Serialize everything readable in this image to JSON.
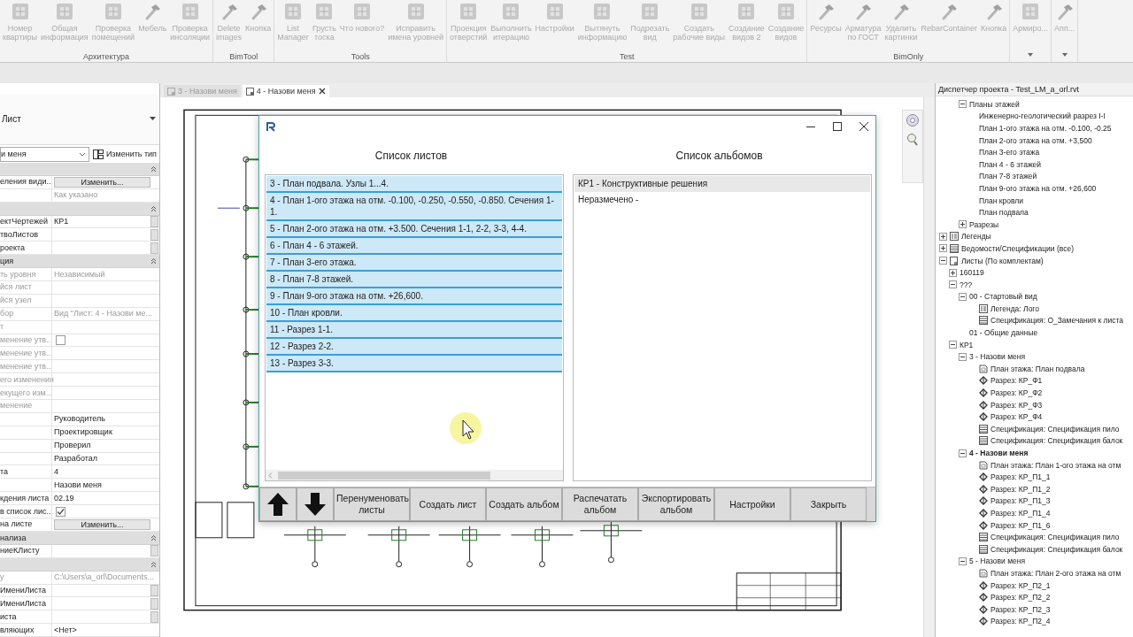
{
  "ribbon": {
    "groups": [
      {
        "title": "Архитектура",
        "dropdown": false,
        "buttons": [
          {
            "kind": "tile",
            "lines": [
              "Номер",
              "квартиры"
            ]
          },
          {
            "kind": "tile",
            "lines": [
              "Общая",
              "информация"
            ]
          },
          {
            "kind": "tile",
            "lines": [
              "Проверка",
              "помещений"
            ]
          },
          {
            "kind": "hammer",
            "lines": [
              "Мебель"
            ]
          },
          {
            "kind": "tile",
            "lines": [
              "Проверка",
              "инсоляции"
            ]
          }
        ]
      },
      {
        "title": "BimTool",
        "dropdown": false,
        "buttons": [
          {
            "kind": "hammer",
            "lines": [
              "Delete",
              "images"
            ]
          },
          {
            "kind": "hammer",
            "lines": [
              "Кнопка"
            ]
          }
        ]
      },
      {
        "title": "Tools",
        "dropdown": false,
        "buttons": [
          {
            "kind": "tile",
            "lines": [
              "List",
              "Manager"
            ]
          },
          {
            "kind": "tile",
            "lines": [
              "Грусть",
              "тоска"
            ]
          },
          {
            "kind": "tile",
            "lines": [
              "Что нового?"
            ]
          },
          {
            "kind": "tile",
            "lines": [
              "Исправить",
              "имена уровней"
            ]
          }
        ]
      },
      {
        "title": "Test",
        "dropdown": false,
        "buttons": [
          {
            "kind": "tile",
            "lines": [
              "Проекция",
              "отверстий"
            ]
          },
          {
            "kind": "tile",
            "lines": [
              "Выполнить",
              "итерацию"
            ]
          },
          {
            "kind": "tile",
            "lines": [
              "Настройки"
            ]
          },
          {
            "kind": "tile",
            "lines": [
              "Вытянуть",
              "информацию"
            ]
          },
          {
            "kind": "tile",
            "lines": [
              "Подрезать",
              "вид"
            ]
          },
          {
            "kind": "tile",
            "lines": [
              "Создать",
              "рабочие виды"
            ]
          },
          {
            "kind": "tile",
            "lines": [
              "Создание",
              "видов 2"
            ]
          },
          {
            "kind": "tile",
            "lines": [
              "Создание",
              "видов"
            ]
          }
        ]
      },
      {
        "title": "BimOnly",
        "dropdown": false,
        "buttons": [
          {
            "kind": "hammer",
            "lines": [
              "Ресурсы"
            ]
          },
          {
            "kind": "hammer",
            "lines": [
              "Арматура",
              "по ГОСТ"
            ]
          },
          {
            "kind": "hammer",
            "lines": [
              "Удалить",
              "картинки"
            ]
          },
          {
            "kind": "hammer",
            "lines": [
              "RebarContainer"
            ]
          },
          {
            "kind": "hammer",
            "lines": [
              "Кнопка"
            ]
          }
        ]
      },
      {
        "dropdown": true,
        "buttons": [
          {
            "kind": "tile",
            "lines": [
              "Армиро..."
            ]
          }
        ]
      },
      {
        "dropdown": true,
        "buttons": [
          {
            "kind": "hammer",
            "lines": [
              "Апп..."
            ]
          }
        ]
      }
    ]
  },
  "properties": {
    "type_name": "Лист",
    "instance_selector": "и меня",
    "edit_type_button": "Изменить тип",
    "rows": [
      {
        "kind": "header"
      },
      {
        "kind": "button",
        "label": "еления види...",
        "button": "Изменить...",
        "disabled": false
      },
      {
        "kind": "text",
        "value": "Как указано",
        "disabled": true
      },
      {
        "kind": "header"
      },
      {
        "kind": "param",
        "label": "ектЧертежей",
        "value": "КР1",
        "disabled": false
      },
      {
        "kind": "param",
        "label": "твоЛистов",
        "disabled": false
      },
      {
        "kind": "param",
        "label": "роекта",
        "disabled": false
      },
      {
        "kind": "header",
        "label": "ция"
      },
      {
        "kind": "text",
        "label": "ть уровня",
        "value": "Независимый",
        "disabled": true
      },
      {
        "kind": "text",
        "label": "йся лист",
        "disabled": true
      },
      {
        "kind": "text",
        "label": "йся узел",
        "disabled": true
      },
      {
        "kind": "text",
        "label": "бор",
        "value": "Вид \"Лист: 4 - Назови ме...",
        "disabled": true
      },
      {
        "kind": "text",
        "label": "т",
        "disabled": true
      },
      {
        "kind": "checkbox",
        "label": "менение утв...",
        "checked": false,
        "disabled": true
      },
      {
        "kind": "text",
        "label": "менение утв...",
        "disabled": true
      },
      {
        "kind": "text",
        "label": "менение утв...",
        "disabled": true
      },
      {
        "kind": "text",
        "label": "его изменения",
        "disabled": true
      },
      {
        "kind": "text",
        "label": "екущего изм...",
        "disabled": true
      },
      {
        "kind": "text",
        "label": "менение",
        "disabled": true
      },
      {
        "kind": "text",
        "value": "Руководитель",
        "disabled": false
      },
      {
        "kind": "text",
        "value": "Проектировщик",
        "disabled": false
      },
      {
        "kind": "text",
        "value": "Проверил",
        "disabled": false
      },
      {
        "kind": "text",
        "value": "Разработал",
        "disabled": false
      },
      {
        "kind": "text",
        "label": "та",
        "value": "4",
        "disabled": false
      },
      {
        "kind": "text",
        "value": "Назови меня",
        "disabled": false
      },
      {
        "kind": "text",
        "label": "кдения листа",
        "value": "02.19",
        "disabled": false
      },
      {
        "kind": "checkbox",
        "label": "в список лис...",
        "checked": true,
        "disabled": false
      },
      {
        "kind": "button",
        "label": "на листе",
        "button": "Изменить...",
        "disabled": false
      },
      {
        "kind": "header",
        "label": "нализа"
      },
      {
        "kind": "param",
        "label": "ниеКЛисту",
        "disabled": false
      },
      {
        "kind": "header"
      },
      {
        "kind": "text",
        "label": "у",
        "value": "C:\\Users\\a_orl\\Documents...",
        "disabled": true
      },
      {
        "kind": "param",
        "label": "ИмениЛиста",
        "disabled": false
      },
      {
        "kind": "param",
        "label": "ИмениЛиста",
        "disabled": false
      },
      {
        "kind": "param",
        "label": "иста",
        "disabled": false
      },
      {
        "kind": "text",
        "label": "вляющих",
        "value": "<Нет>",
        "disabled": false
      }
    ]
  },
  "view_tabs": [
    {
      "label": "3 - Назови меня",
      "selected": false
    },
    {
      "label": "4 - Назови меня",
      "selected": true
    }
  ],
  "dialog": {
    "sheets_header": "Список листов",
    "albums_header": "Список альбомов",
    "sheets": [
      {
        "label": "3 - План подвала. Узлы 1...4.",
        "selected": true
      },
      {
        "label": "4 - План 1-ого этажа на отм. -0.100,  -0.250, -0.550, -0.850. Сечения  1-1.",
        "selected": true
      },
      {
        "label": "5 - План 2-ого этажа на отм. +3.500. Сечения  1-1,  2-2,  3-3,  4-4.",
        "selected": true
      },
      {
        "label": "6 - План 4 - 6  этажей.",
        "selected": true
      },
      {
        "label": "7 - План 3-его этажа.",
        "selected": true
      },
      {
        "label": "8 - План 7-8 этажей.",
        "selected": true
      },
      {
        "label": "9 - План 9-ого этажа на отм. +26,600.",
        "selected": true
      },
      {
        "label": "10 - План кровли.",
        "selected": true
      },
      {
        "label": "11 - Разрез 1-1.",
        "selected": true
      },
      {
        "label": "12 - Разрез 2-2.",
        "selected": true
      },
      {
        "label": "13 - Разрез 3-3.",
        "selected": true
      }
    ],
    "albums": [
      {
        "label": "КР1 - Конструктивные решения",
        "selected": true
      },
      {
        "label": "Неразмечено -",
        "selected": false
      }
    ],
    "buttons": [
      {
        "kind": "up"
      },
      {
        "kind": "down"
      },
      {
        "kind": "text",
        "label": "Перенуменовать листы"
      },
      {
        "kind": "text",
        "label": "Создать лист"
      },
      {
        "kind": "text",
        "label": "Создать альбом"
      },
      {
        "kind": "text",
        "label": "Распечатать альбом"
      },
      {
        "kind": "text",
        "label": "Экспортировать альбом"
      },
      {
        "kind": "text",
        "label": "Настройки"
      },
      {
        "kind": "text",
        "label": "Закрыть"
      }
    ]
  },
  "browser": {
    "title": "Диспетчер проекта - Test_LM_a_orl.rvt",
    "partial_items": [
      {
        "label": "Планы этажей",
        "expanded": true,
        "selected": false,
        "children": [
          {
            "label": "Инженерно-геологический разрез I-I",
            "selected": false
          },
          {
            "label": "План 1-ого этажа на отм. -0.100,  -0.25",
            "selected": false
          },
          {
            "label": "План 2-ого этажа на отм. +3,500",
            "selected": false
          },
          {
            "label": "План 3-его этажа",
            "selected": false
          },
          {
            "label": "План 4 - 6  этажей",
            "selected": false
          },
          {
            "label": "План 7-8 этажей",
            "selected": false
          },
          {
            "label": "План 9-ого этажа на отм. +26,600",
            "selected": false
          },
          {
            "label": "План кровли",
            "selected": false
          },
          {
            "label": "План подвала",
            "selected": false
          }
        ]
      },
      {
        "label": "Разрезы",
        "expanded": false,
        "selected": false
      }
    ],
    "items": [
      {
        "label": "Легенды",
        "kind": "legend",
        "expanded": false,
        "selected": false
      },
      {
        "label": "Ведомости/Спецификации (все)",
        "kind": "schedule",
        "expanded": false,
        "selected": false
      },
      {
        "label": "Листы (По комплектам)",
        "kind": "sheets",
        "expanded": true,
        "selected": false,
        "children": [
          {
            "label": "160119",
            "expanded": false,
            "selected": false
          },
          {
            "label": "???",
            "expanded": true,
            "selected": false,
            "children": [
              {
                "label": "00 - Стартовый вид",
                "expanded": true,
                "selected": false,
                "children": [
                  {
                    "label": "Легенда: Лого",
                    "kind": "legend",
                    "selected": false
                  },
                  {
                    "label": "Спецификация: О_Замечания к листа",
                    "kind": "schedule",
                    "selected": false
                  }
                ]
              },
              {
                "label": "01 - Общие данные",
                "selected": false
              }
            ]
          },
          {
            "label": "КР1",
            "expanded": true,
            "selected": false,
            "children": [
              {
                "label": "3 - Назови меня",
                "expanded": true,
                "selected": false,
                "children": [
                  {
                    "label": "План этажа: План подвала",
                    "kind": "plan",
                    "selected": false
                  },
                  {
                    "label": "Разрез: КР_Ф1",
                    "kind": "section",
                    "selected": false
                  },
                  {
                    "label": "Разрез: КР_Ф2",
                    "kind": "section",
                    "selected": false
                  },
                  {
                    "label": "Разрез: КР_Ф3",
                    "kind": "section",
                    "selected": false
                  },
                  {
                    "label": "Разрез: КР_Ф4",
                    "kind": "section",
                    "selected": false
                  },
                  {
                    "label": "Спецификация: Спецификация  пило",
                    "kind": "schedule",
                    "selected": false
                  },
                  {
                    "label": "Спецификация: Спецификация балок",
                    "kind": "schedule",
                    "selected": false
                  }
                ]
              },
              {
                "label": "4 - Назови меня",
                "expanded": true,
                "selected": true,
                "children": [
                  {
                    "label": "План этажа: План 1-ого этажа на отм",
                    "kind": "plan",
                    "selected": false
                  },
                  {
                    "label": "Разрез: КР_П1_1",
                    "kind": "section",
                    "selected": false
                  },
                  {
                    "label": "Разрез: КР_П1_2",
                    "kind": "section",
                    "selected": false
                  },
                  {
                    "label": "Разрез: КР_П1_3",
                    "kind": "section",
                    "selected": false
                  },
                  {
                    "label": "Разрез: КР_П1_4",
                    "kind": "section",
                    "selected": false
                  },
                  {
                    "label": "Разрез: КР_П1_6",
                    "kind": "section",
                    "selected": false
                  },
                  {
                    "label": "Спецификация: Спецификация  пило",
                    "kind": "schedule",
                    "selected": false
                  },
                  {
                    "label": "Спецификация: Спецификация балок",
                    "kind": "schedule",
                    "selected": false
                  }
                ]
              },
              {
                "label": "5 - Назови меня",
                "expanded": true,
                "selected": false,
                "children": [
                  {
                    "label": "План этажа: План 2-ого этажа на отм",
                    "kind": "plan",
                    "selected": false
                  },
                  {
                    "label": "Разрез: КР_П2_1",
                    "kind": "section",
                    "selected": false
                  },
                  {
                    "label": "Разрез: КР_П2_2",
                    "kind": "section",
                    "selected": false
                  },
                  {
                    "label": "Разрез: КР_П2_3",
                    "kind": "section",
                    "selected": false
                  },
                  {
                    "label": "Разрез: КР_П2_4",
                    "kind": "section",
                    "selected": false
                  }
                ]
              }
            ]
          }
        ]
      }
    ]
  }
}
